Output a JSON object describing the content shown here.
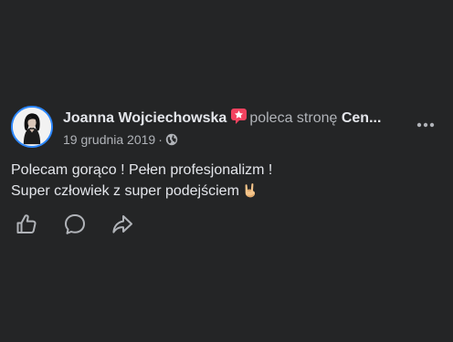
{
  "post": {
    "author": "Joanna Wojciechowska",
    "verb": "poleca stronę",
    "page_name": "Cen...",
    "date": "19 grudnia 2019",
    "separator": "·",
    "privacy_icon": "globe-icon",
    "recommend_badge_icon": "recommend-star-icon",
    "body_lines": [
      "Polecam gorąco ! Pełen profesjonalizm !",
      "Super człowiek z super podejściem"
    ],
    "body_emoji": "horns-hand-emoji"
  },
  "actions": [
    {
      "name": "like",
      "icon": "thumbs-up-icon"
    },
    {
      "name": "comment",
      "icon": "comment-bubble-icon"
    },
    {
      "name": "share",
      "icon": "share-arrow-icon"
    }
  ],
  "more_icon": "more-options-icon",
  "colors": {
    "background": "#242526",
    "primary_text": "#e4e6eb",
    "secondary_text": "#b0b3b8",
    "avatar_ring": "#2d88ff",
    "recommend_badge": "#f3425f"
  }
}
